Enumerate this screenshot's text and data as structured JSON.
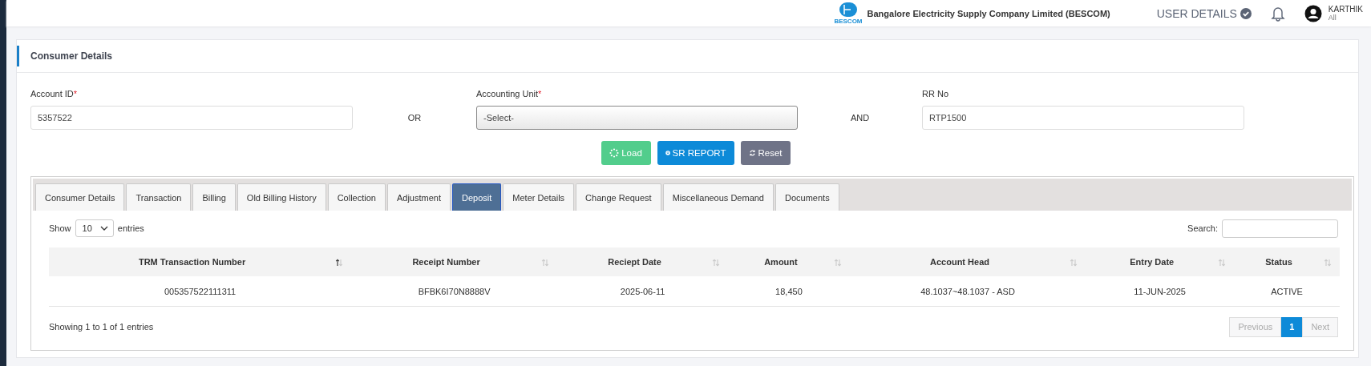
{
  "header": {
    "logo_text": "BESCOM",
    "company": "Bangalore Electricity Supply Company Limited (BESCOM)",
    "user_details": "USER DETAILS",
    "user_name": "KARTHIK",
    "user_role": "All"
  },
  "card": {
    "title": "Consumer Details",
    "fields": [
      {
        "label": "Account ID",
        "required_mark": "*",
        "kind": "input",
        "value": "5357522"
      },
      {
        "kind": "joiner",
        "text": "OR"
      },
      {
        "label": "Accounting Unit",
        "required_mark": "*",
        "kind": "select",
        "value": "-Select-"
      },
      {
        "kind": "joiner",
        "text": "AND"
      },
      {
        "label": "RR No",
        "kind": "input",
        "value": "RTP1500"
      }
    ],
    "buttons": [
      {
        "label": "Load",
        "kind": "load"
      },
      {
        "label": "SR REPORT",
        "kind": "report"
      },
      {
        "label": "Reset",
        "kind": "reset"
      }
    ],
    "tabs": [
      {
        "label": "Consumer Details",
        "selected": false
      },
      {
        "label": "Transaction",
        "selected": false
      },
      {
        "label": "Billing",
        "selected": false
      },
      {
        "label": "Old Billing History",
        "selected": false
      },
      {
        "label": "Collection",
        "selected": false
      },
      {
        "label": "Adjustment",
        "selected": false
      },
      {
        "label": "Deposit",
        "selected": true
      },
      {
        "label": "Meter Details",
        "selected": false
      },
      {
        "label": "Change Request",
        "selected": false
      },
      {
        "label": "Miscellaneous Demand",
        "selected": false
      },
      {
        "label": "Documents",
        "selected": false
      }
    ],
    "table": {
      "show_label": "Show",
      "page_size": "10",
      "entries_label": "entries",
      "search_label": "Search:",
      "columns": [
        {
          "label": "TRM Transaction Number",
          "sorted": true
        },
        {
          "label": "Receipt Number",
          "sorted": false
        },
        {
          "label": "Reciept Date",
          "sorted": false
        },
        {
          "label": "Amount",
          "sorted": false
        },
        {
          "label": "Account Head",
          "sorted": false
        },
        {
          "label": "Entry Date",
          "sorted": false
        },
        {
          "label": "Status",
          "sorted": false
        }
      ],
      "rows": [
        [
          "005357522111311",
          "BFBK6I70N8888V",
          "2025-06-11",
          "18,450",
          "48.1037~48.1037 - ASD",
          "11-JUN-2025",
          "ACTIVE"
        ]
      ],
      "info": "Showing 1 to 1 of 1 entries",
      "pagination": [
        {
          "label": "Previous",
          "kind": "nav",
          "disabled": true,
          "selected": false
        },
        {
          "label": "1",
          "kind": "page",
          "disabled": false,
          "selected": true
        },
        {
          "label": "Next",
          "kind": "nav",
          "disabled": true,
          "selected": false
        }
      ]
    }
  }
}
